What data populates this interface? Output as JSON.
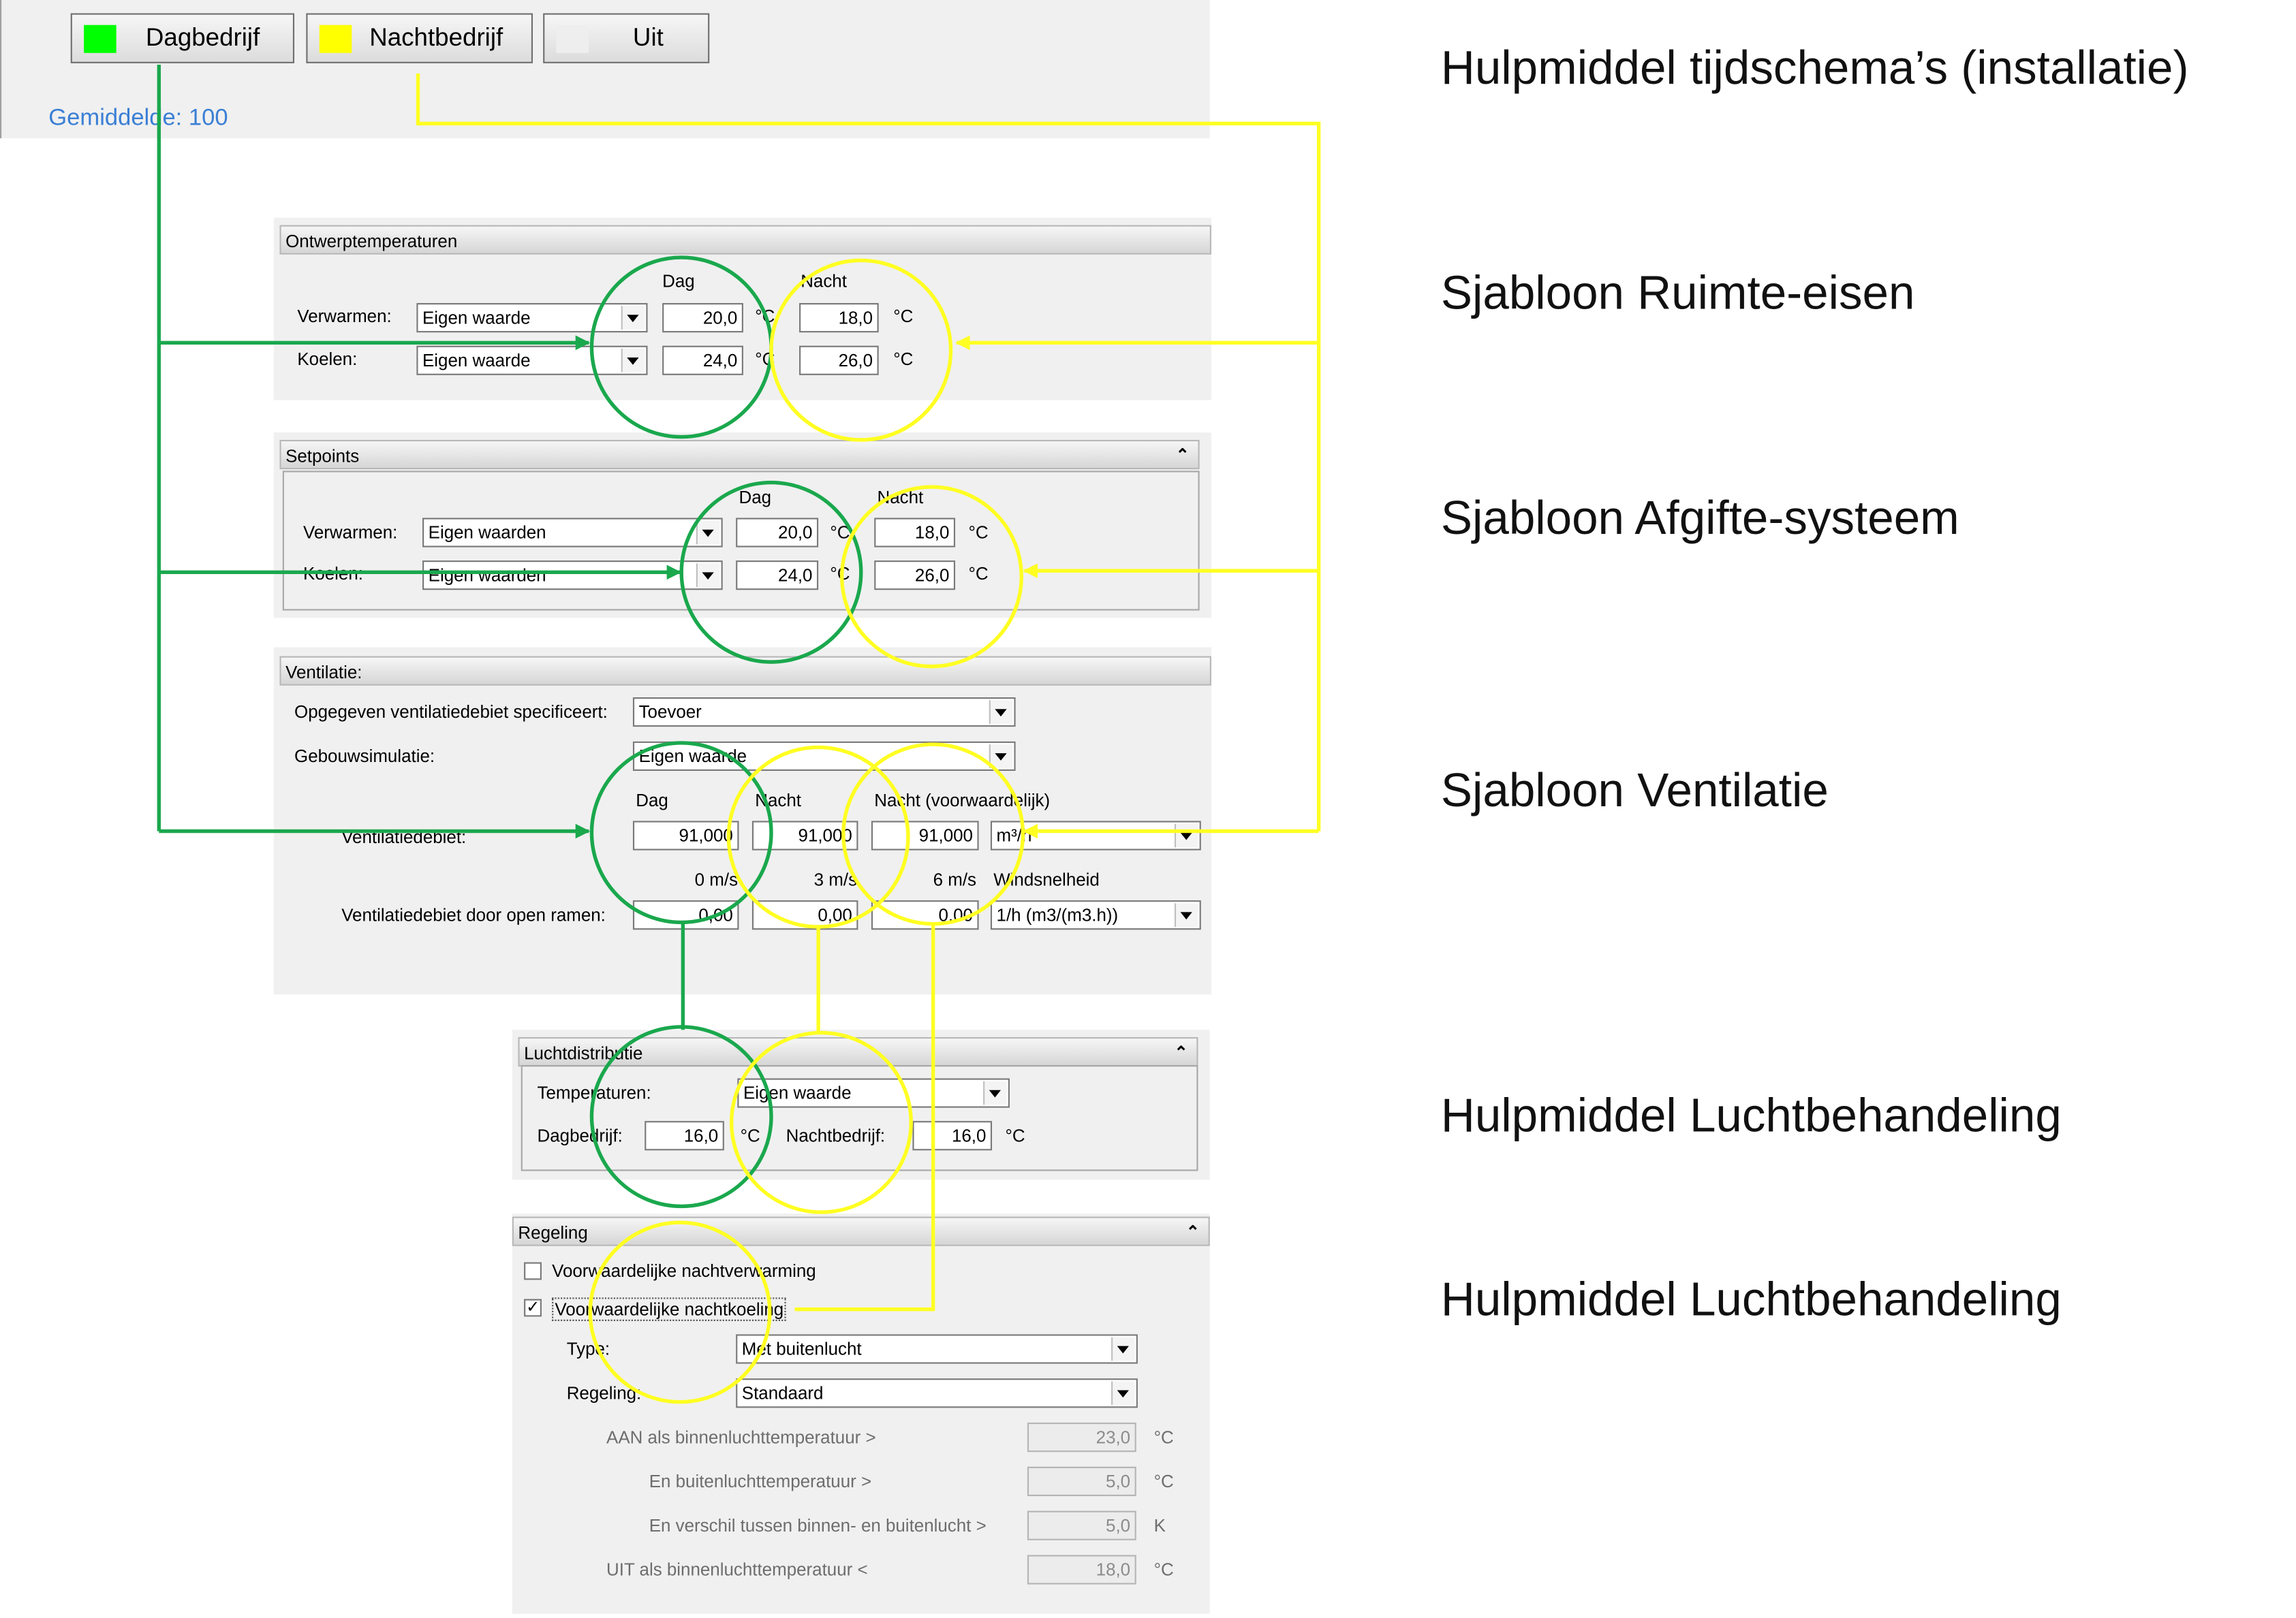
{
  "colors": {
    "green": "#1aa84d",
    "yellow": "#ffff22",
    "green_swatch": "#00ff00",
    "yellow_swatch": "#ffff00",
    "off_swatch": "#eeeeee"
  },
  "modes": {
    "dag_label": "Dagbedrijf",
    "nacht_label": "Nachtbedrijf",
    "uit_label": "Uit",
    "average_text": "Gemiddelde: 100"
  },
  "ontwerp": {
    "title": "Ontwerptemperaturen",
    "col_dag": "Dag",
    "col_nacht": "Nacht",
    "rows": [
      {
        "label": "Verwarmen:",
        "option": "Eigen waarde",
        "dag": "20,0",
        "nacht": "18,0",
        "unit": "°C"
      },
      {
        "label": "Koelen:",
        "option": "Eigen waarde",
        "dag": "24,0",
        "nacht": "26,0",
        "unit": "°C"
      }
    ]
  },
  "setpoints": {
    "title": "Setpoints",
    "col_dag": "Dag",
    "col_nacht": "Nacht",
    "rows": [
      {
        "label": "Verwarmen:",
        "option": "Eigen waarden",
        "dag": "20,0",
        "nacht": "18,0",
        "unit": "°C"
      },
      {
        "label": "Koelen:",
        "option": "Eigen waarden",
        "dag": "24,0",
        "nacht": "26,0",
        "unit": "°C"
      }
    ]
  },
  "ventilatie": {
    "title": "Ventilatie:",
    "spec_label": "Opgegeven ventilatiedebiet specificeert:",
    "spec_value": "Toevoer",
    "sim_label": "Gebouwsimulatie:",
    "sim_value": "Eigen waarde",
    "col_dag": "Dag",
    "col_nacht": "Nacht",
    "col_nacht_cond": "Nacht (voorwaardelijk)",
    "debiet_label": "Ventilatiedebiet:",
    "debiet_dag": "91,000",
    "debiet_nacht": "91,000",
    "debiet_cond": "91,000",
    "debiet_unit": "m³/h",
    "wind_0": "0 m/s",
    "wind_3": "3 m/s",
    "wind_6": "6 m/s",
    "wind_label": "Windsnelheid",
    "ramen_label": "Ventilatiedebiet door open ramen:",
    "ramen_0": "0,00",
    "ramen_3": "0,00",
    "ramen_6": "0,00",
    "ramen_unit": "1/h (m3/(m3.h))"
  },
  "lucht": {
    "title": "Luchtdistributie",
    "temp_label": "Temperaturen:",
    "temp_value": "Eigen waarde",
    "dag_label": "Dagbedrijf:",
    "dag_value": "16,0",
    "dag_unit": "°C",
    "nacht_label": "Nachtbedrijf:",
    "nacht_value": "16,0",
    "nacht_unit": "°C"
  },
  "regeling": {
    "title": "Regeling",
    "cb1_label": "Voorwaardelijke nachtverwarming",
    "cb2_label": "Voorwaardelijke nachtkoeling",
    "cb2_mark": "✓",
    "type_label": "Type:",
    "type_value": "Met buitenlucht",
    "reg_label": "Regeling:",
    "reg_value": "Standaard",
    "rows": [
      {
        "label": "AAN als binnenluchttemperatuur >",
        "value": "23,0",
        "unit": "°C"
      },
      {
        "label": "En buitenluchttemperatuur >",
        "value": "5,0",
        "unit": "°C"
      },
      {
        "label": "En verschil tussen binnen- en buitenlucht >",
        "value": "5,0",
        "unit": "K"
      },
      {
        "label": "UIT als binnenluchttemperatuur <",
        "value": "18,0",
        "unit": "°C"
      }
    ]
  },
  "descriptions": {
    "d1": "Hulpmiddel tijdschema’s (installatie)",
    "d2": "Sjabloon Ruimte-eisen",
    "d3": "Sjabloon Afgifte-systeem",
    "d4": "Sjabloon Ventilatie",
    "d5": "Hulpmiddel Luchtbehandeling",
    "d6": "Hulpmiddel Luchtbehandeling"
  }
}
